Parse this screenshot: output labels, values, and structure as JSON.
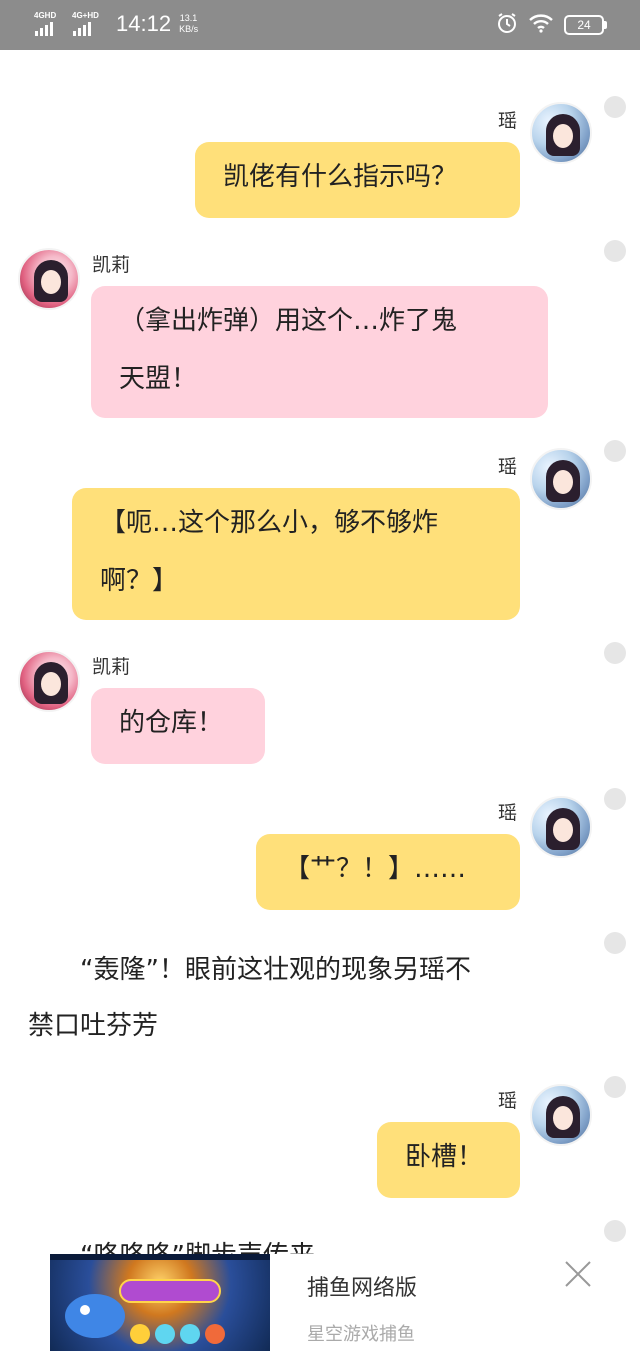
{
  "status_bar": {
    "net1": "4GHD",
    "net2": "4G+HD",
    "time": "14:12",
    "speed_value": "13.1",
    "speed_unit": "KB/s",
    "battery": "24",
    "icons": [
      "alarm-icon",
      "wifi-icon",
      "battery-icon"
    ]
  },
  "chat": [
    {
      "type": "msg",
      "speaker": "瑶",
      "side": "right",
      "text": "凯佬有什么指示吗？"
    },
    {
      "type": "msg",
      "speaker": "凯莉",
      "side": "left",
      "lines": [
        "（拿出炸弹）用这个…炸了鬼",
        "天盟！"
      ]
    },
    {
      "type": "msg",
      "speaker": "瑶",
      "side": "right",
      "lines": [
        "【呃…这个那么小，够不够炸",
        "啊？】"
      ]
    },
    {
      "type": "msg",
      "speaker": "凯莉",
      "side": "left",
      "text": "的仓库！"
    },
    {
      "type": "msg",
      "speaker": "瑶",
      "side": "right",
      "text": "【艹？！】……"
    },
    {
      "type": "narration",
      "lines": [
        "　　“轰隆”！眼前这壮观的现象另瑶不",
        "禁口吐芬芳"
      ]
    },
    {
      "type": "msg",
      "speaker": "瑶",
      "side": "right",
      "text": "卧槽！"
    },
    {
      "type": "narration",
      "lines": [
        "　　“咚咚咚”脚步声传来"
      ]
    }
  ],
  "ad": {
    "title": "捕鱼网络版",
    "subtitle": "星空游戏捕鱼"
  }
}
